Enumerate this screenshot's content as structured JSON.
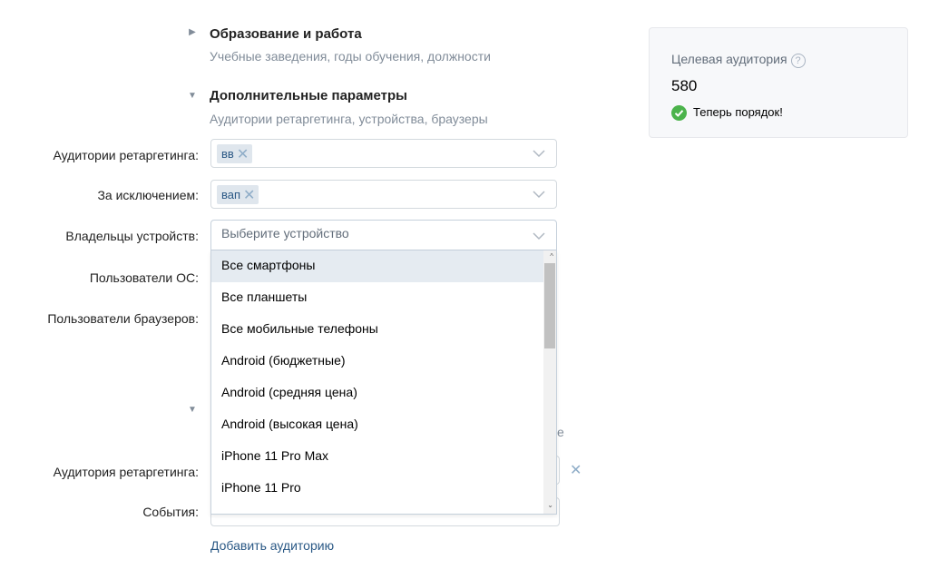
{
  "sections": {
    "education": {
      "title": "Образование и работа",
      "subtitle": "Учебные заведения, годы обучения, должности"
    },
    "additional": {
      "title": "Дополнительные параметры",
      "subtitle": "Аудитории ретаргетинга, устройства, браузеры"
    }
  },
  "fields": {
    "retargeting_audiences": {
      "label": "Аудитории ретаргетинга:",
      "tag": "вв"
    },
    "except": {
      "label": "За исключением:",
      "tag": "вап"
    },
    "device_owners": {
      "label": "Владельцы устройств:",
      "placeholder": "Выберите устройство"
    },
    "os_users": {
      "label": "Пользователи ОС:"
    },
    "browser_users": {
      "label": "Пользователи браузеров:"
    },
    "retargeting_audience": {
      "label": "Аудитория ретаргетинга:"
    },
    "events": {
      "label": "События:"
    }
  },
  "device_options": [
    "Все смартфоны",
    "Все планшеты",
    "Все мобильные телефоны",
    "Android (бюджетные)",
    "Android (средняя цена)",
    "Android (высокая цена)",
    "iPhone 11 Pro Max",
    "iPhone 11 Pro"
  ],
  "selected_option_index": 0,
  "add_audience_link": "Добавить аудиторию",
  "audience_panel": {
    "title": "Целевая аудитория",
    "help": "?",
    "count": "580",
    "status": "Теперь порядок!"
  },
  "colors": {
    "link": "#2a5885",
    "success": "#4bb34b",
    "muted": "#818c99"
  }
}
